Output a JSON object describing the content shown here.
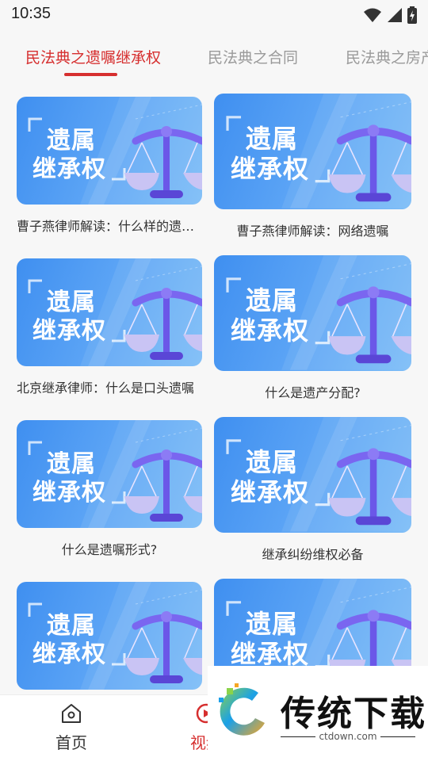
{
  "status_bar": {
    "time": "10:35"
  },
  "tabs": [
    {
      "label": "民法典之遗嘱继承权",
      "active": true
    },
    {
      "label": "民法典之合同",
      "active": false
    },
    {
      "label": "民法典之房产",
      "active": false
    }
  ],
  "thumbnail": {
    "line1": "遗属",
    "line2": "继承权"
  },
  "articles": [
    {
      "caption": "曹子燕律师解读：什么样的遗嘱有效"
    },
    {
      "caption": "曹子燕律师解读：网络遗嘱"
    },
    {
      "caption": "北京继承律师：什么是口头遗嘱"
    },
    {
      "caption": "什么是遗产分配?"
    },
    {
      "caption": "什么是遗嘱形式?"
    },
    {
      "caption": "继承纠纷维权必备"
    },
    {
      "caption": ""
    },
    {
      "caption": ""
    }
  ],
  "bottom_nav": {
    "home": {
      "label": "首页",
      "icon": "home-icon"
    },
    "video": {
      "label": "视频",
      "icon": "video-icon"
    }
  },
  "watermark": {
    "brand": "传统下载",
    "url": "ctdown.com"
  },
  "colors": {
    "accent": "#d62f2f",
    "thumb_blue": "#4a97f2"
  }
}
